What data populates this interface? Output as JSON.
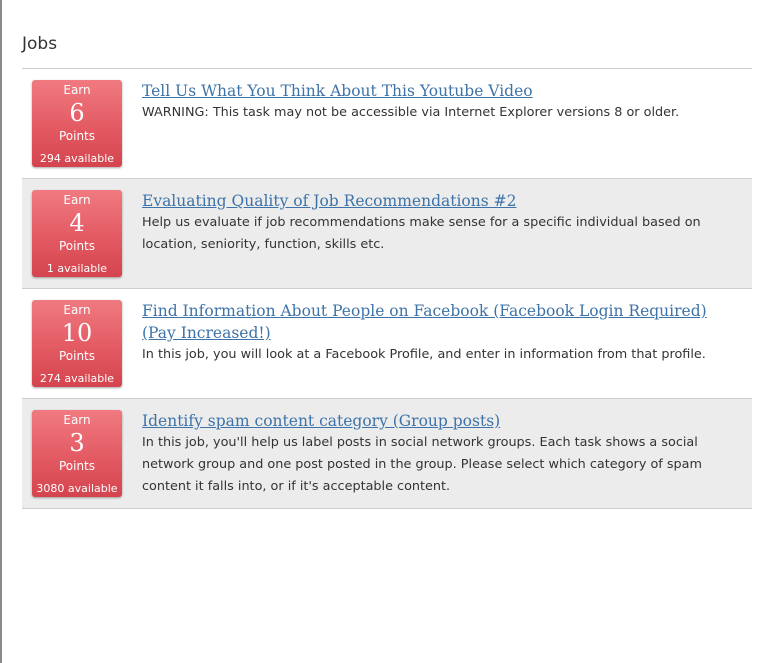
{
  "page": {
    "title": "Jobs"
  },
  "jobs": [
    {
      "earn_label": "Earn",
      "points": "6",
      "points_label": "Points",
      "available": "294 available",
      "title": "Tell Us What You Think About This Youtube Video",
      "description": "WARNING: This task may not be accessible via Internet Explorer versions 8 or older."
    },
    {
      "earn_label": "Earn",
      "points": "4",
      "points_label": "Points",
      "available": "1 available",
      "title": "Evaluating Quality of Job Recommendations #2",
      "description": "Help us evaluate if job recommendations make sense for a specific individual based on location, seniority, function, skills etc."
    },
    {
      "earn_label": "Earn",
      "points": "10",
      "points_label": "Points",
      "available": "274 available",
      "title": "Find Information About People on Facebook (Facebook Login Required)(Pay Increased!)",
      "description": "In this job, you will look at a Facebook Profile, and enter in information from that profile."
    },
    {
      "earn_label": "Earn",
      "points": "3",
      "points_label": "Points",
      "available": "3080 available",
      "title": "Identify spam content category (Group posts)",
      "description": "In this job, you'll help us label posts in social network groups. Each task shows a social network group and one post posted in the group. Please select which category of spam content it falls into, or if it's acceptable content."
    }
  ],
  "colors": {
    "badge": "#e35a63",
    "link": "#3d73a8",
    "alt_row": "#ececec"
  }
}
